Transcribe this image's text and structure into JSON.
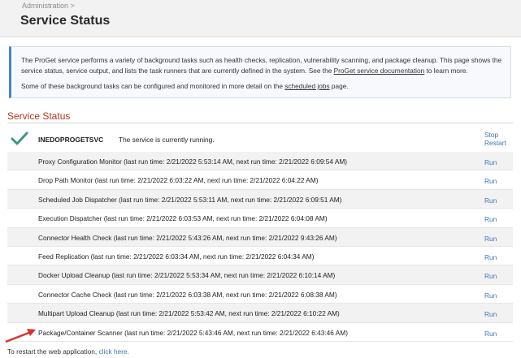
{
  "header": {
    "breadcrumb": "Administration >",
    "title": "Service Status"
  },
  "info": {
    "p1_start": "The ProGet service performs a variety of background tasks such as health checks, replication, vulnerability scanning, and package cleanup. This page shows the service status, service output, and lists the task runners that are currently defined in the system. See the ",
    "p1_link": "ProGet service documentation",
    "p1_end": " to learn more.",
    "p2_start": "Some of these background tasks can be configured and monitored in more detail on the ",
    "p2_link": "scheduled jobs",
    "p2_end": " page."
  },
  "section_title": "Service Status",
  "service": {
    "name": "INEDOPROGETSVC",
    "status": "The service is currently running.",
    "stop_label": "Stop",
    "restart_label": "Restart",
    "status_color": "#3a9a7a"
  },
  "run_label": "Run",
  "tasks": [
    "Proxy Configuration Monitor (last run time: 2/21/2022 5:53:14 AM, next run time: 2/21/2022 6:09:54 AM)",
    "Drop Path Monitor (last run time: 2/21/2022 6:03:22 AM, next run time: 2/21/2022 6:04:22 AM)",
    "Scheduled Job Dispatcher (last run time: 2/21/2022 5:53:11 AM, next run time: 2/21/2022 6:09:51 AM)",
    "Execution Dispatcher (last run time: 2/21/2022 6:03:53 AM, next run time: 2/21/2022 6:04:08 AM)",
    "Connector Health Check (last run time: 2/21/2022 5:43:26 AM, next run time: 2/21/2022 9:43:26 AM)",
    "Feed Replication (last run time: 2/21/2022 6:03:34 AM, next run time: 2/21/2022 6:04:34 AM)",
    "Docker Upload Cleanup (last run time: 2/21/2022 5:53:34 AM, next run time: 2/21/2022 6:10:14 AM)",
    "Connector Cache Check (last run time: 2/21/2022 6:03:38 AM, next run time: 2/21/2022 6:08:38 AM)",
    "Multipart Upload Cleanup (last run time: 2/21/2022 5:53:42 AM, next run time: 2/21/2022 6:10:22 AM)",
    "Package/Container Scanner (last run time: 2/21/2022 5:43:46 AM, next run time: 2/21/2022 6:43:46 AM)"
  ],
  "footer": {
    "text": "To restart the web application, ",
    "link": "click here."
  },
  "colors": {
    "link": "#3a74b6",
    "section_title": "#b3361e",
    "annotation_arrow": "#d9302b"
  }
}
